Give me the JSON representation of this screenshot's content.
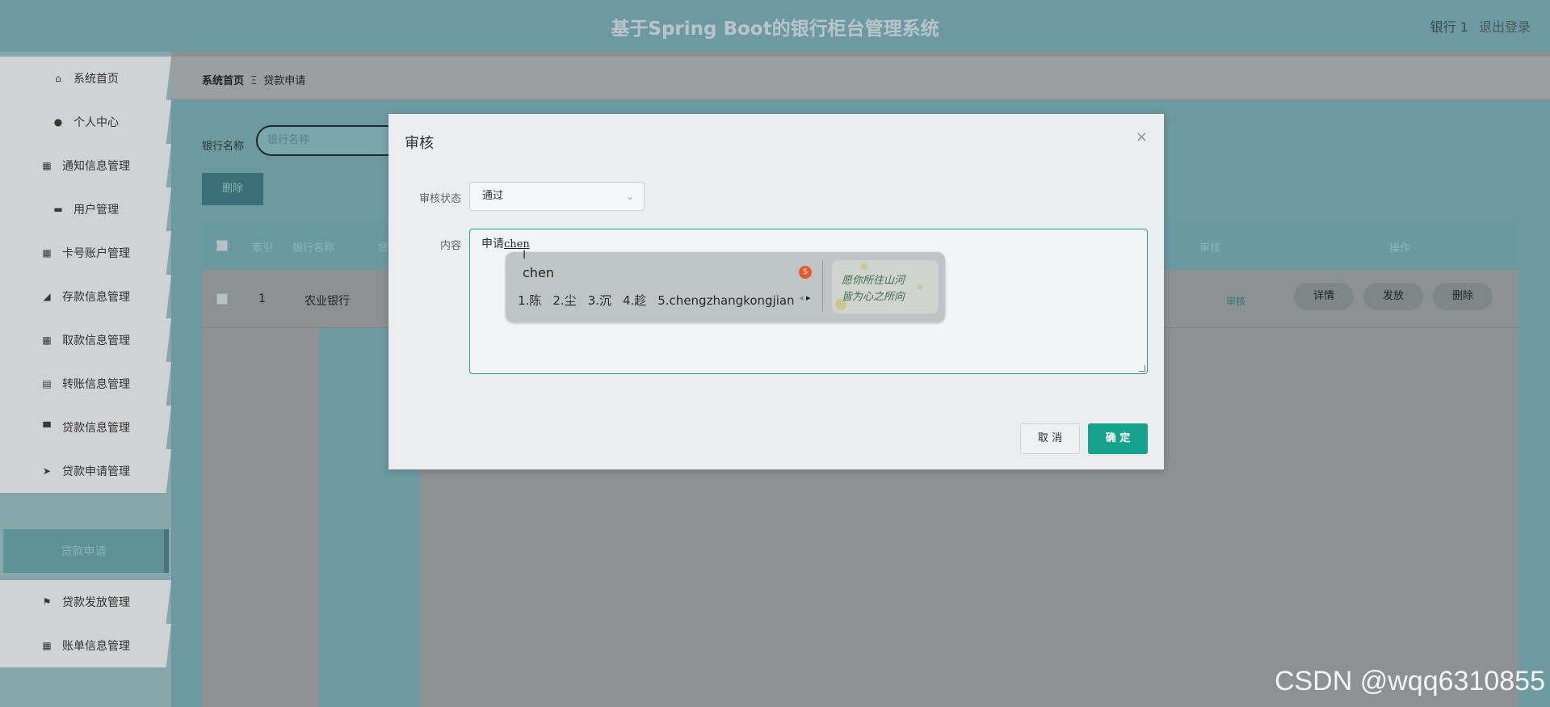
{
  "header": {
    "title": "基于Spring Boot的银行柜台管理系统",
    "user": "银行 1",
    "logout": "退出登录"
  },
  "sidebar": {
    "items": [
      {
        "label": "系统首页",
        "icon": "home-icon"
      },
      {
        "label": "个人中心",
        "icon": "user-icon"
      },
      {
        "label": "通知信息管理",
        "icon": "grid-icon"
      },
      {
        "label": "用户管理",
        "icon": "chat-icon"
      },
      {
        "label": "卡号账户管理",
        "icon": "grid-icon"
      },
      {
        "label": "存款信息管理",
        "icon": "chart-icon"
      },
      {
        "label": "取款信息管理",
        "icon": "grid-icon"
      },
      {
        "label": "转账信息管理",
        "icon": "clipboard-icon"
      },
      {
        "label": "贷款信息管理",
        "icon": "briefcase-icon"
      },
      {
        "label": "贷款申请管理",
        "icon": "send-icon"
      },
      {
        "label": "贷款申请",
        "icon": ""
      },
      {
        "label": "贷款发放管理",
        "icon": "flag-icon"
      },
      {
        "label": "账单信息管理",
        "icon": "grid-icon"
      }
    ]
  },
  "breadcrumb": {
    "home": "系统首页",
    "sep": "Ξ",
    "current": "贷款申请"
  },
  "search": {
    "label": "银行名称",
    "placeholder": "银行名称"
  },
  "toolbar": {
    "delete_label": "删除"
  },
  "table": {
    "headers": {
      "index": "索引",
      "bank": "银行名称",
      "col3": "贷",
      "audit": "审核",
      "actions": "操作"
    },
    "rows": [
      {
        "index": "1",
        "bank": "农业银行",
        "audit_link": "审核",
        "actions": [
          "详情",
          "发放",
          "删除"
        ]
      }
    ]
  },
  "modal": {
    "title": "审核",
    "close": "×",
    "status_label": "审核状态",
    "status_value": "通过",
    "content_label": "内容",
    "content_text": "申请",
    "content_composing": "chen",
    "cancel": "取 消",
    "confirm": "确 定"
  },
  "ime": {
    "composition": "chen",
    "candidates": [
      "1.陈",
      "2.尘",
      "3.沉",
      "4.趁",
      "5.chengzhangkongjian"
    ],
    "skin_text_line1": "愿你所往山河",
    "skin_text_line2": "皆为心之所向"
  },
  "watermark": "CSDN @wqq6310855",
  "colors": {
    "accent": "#16a28d",
    "header": "#6d9aa2",
    "active_sidebar": "#5e9198"
  }
}
